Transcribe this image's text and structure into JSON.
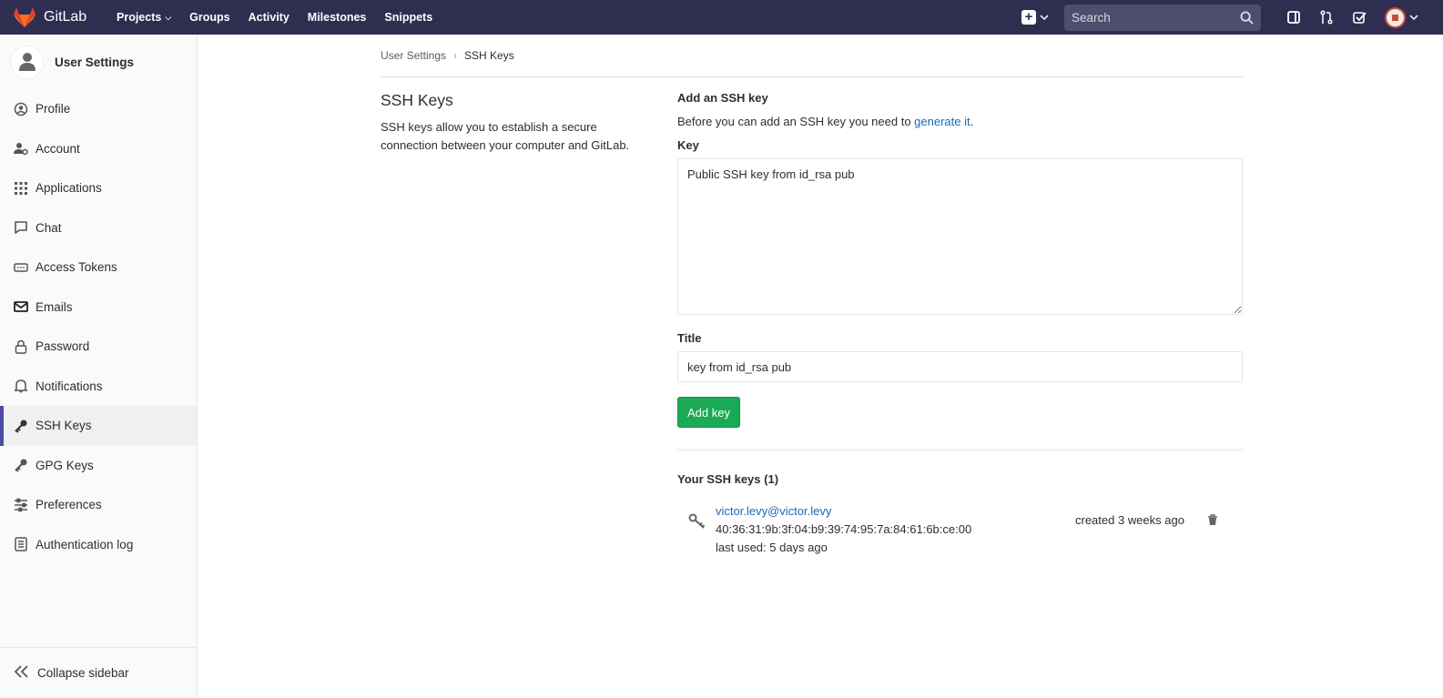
{
  "topbar": {
    "brand": "GitLab",
    "nav": [
      {
        "label": "Projects",
        "has_dropdown": true
      },
      {
        "label": "Groups"
      },
      {
        "label": "Activity"
      },
      {
        "label": "Milestones"
      },
      {
        "label": "Snippets"
      }
    ],
    "search_placeholder": "Search",
    "bg_color": "#2f2e51"
  },
  "sidebar": {
    "title": "User Settings",
    "items": [
      {
        "label": "Profile",
        "icon": "profile-icon"
      },
      {
        "label": "Account",
        "icon": "account-icon"
      },
      {
        "label": "Applications",
        "icon": "applications-icon"
      },
      {
        "label": "Chat",
        "icon": "chat-icon"
      },
      {
        "label": "Access Tokens",
        "icon": "access-tokens-icon"
      },
      {
        "label": "Emails",
        "icon": "emails-icon"
      },
      {
        "label": "Password",
        "icon": "lock-icon"
      },
      {
        "label": "Notifications",
        "icon": "bell-icon"
      },
      {
        "label": "SSH Keys",
        "icon": "key-icon",
        "active": true
      },
      {
        "label": "GPG Keys",
        "icon": "key-icon"
      },
      {
        "label": "Preferences",
        "icon": "preferences-icon"
      },
      {
        "label": "Authentication log",
        "icon": "log-icon"
      }
    ],
    "collapse_label": "Collapse sidebar"
  },
  "breadcrumb": {
    "parent": "User Settings",
    "current": "SSH Keys"
  },
  "info": {
    "heading": "SSH Keys",
    "description": "SSH keys allow you to establish a secure connection between your computer and GitLab."
  },
  "form": {
    "heading": "Add an SSH key",
    "intro_text": "Before you can add an SSH key you need to ",
    "intro_link": "generate it",
    "intro_suffix": ".",
    "key_label": "Key",
    "key_value": "Public SSH key from id_rsa pub",
    "title_label": "Title",
    "title_value": "key from id_rsa pub",
    "submit_label": "Add key",
    "submit_color": "#1aaa55"
  },
  "keys_section": {
    "heading": "Your SSH keys (1)",
    "keys": [
      {
        "title": "victor.levy@victor.levy",
        "fingerprint": "40:36:31:9b:3f:04:b9:39:74:95:7a:84:61:6b:ce:00",
        "last_used": "last used: 5 days ago",
        "created": "created 3 weeks ago"
      }
    ]
  }
}
